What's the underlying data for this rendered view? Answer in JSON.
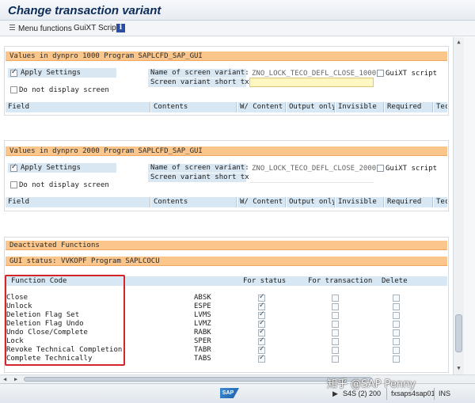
{
  "window": {
    "title": "Change transaction variant"
  },
  "toolbar": {
    "menu_functions": "Menu functions",
    "guixt_script": "GuiXT Script",
    "info": "i"
  },
  "dynpro1000": {
    "header": "Values in dynpro 1000 Program  SAPLCFD_SAP_GUI",
    "apply_settings": "Apply Settings",
    "apply_checked": true,
    "do_not_display": "Do not display screen",
    "do_not_display_checked": false,
    "name_label": "Name of screen variant:",
    "name_value": "ZNO_LOCK_TECO_DEFL_CLOSE_1000",
    "short_txt_label": "Screen variant short txt",
    "short_txt_value": "",
    "guixt_label": "GuiXT script",
    "guixt_checked": false
  },
  "dynpro2000": {
    "header": "Values in dynpro 2000 Program  SAPLCFD_SAP_GUI",
    "apply_settings": "Apply Settings",
    "apply_checked": true,
    "do_not_display": "Do not display screen",
    "do_not_display_checked": false,
    "name_label": "Name of screen variant:",
    "name_value": "ZNO_LOCK_TECO_DEFL_CLOSE_2000",
    "short_txt_label": "Screen variant short txt",
    "short_txt_value": "",
    "guixt_label": "GuiXT script",
    "guixt_checked": false
  },
  "columns": [
    "Field",
    "Contents",
    "W/ Content",
    "Output only",
    "Invisible",
    "Required",
    "Tec"
  ],
  "deactivated": {
    "header": "Deactivated Functions",
    "gui_status": "GUI status: VVKOPF Program SAPLCOCU",
    "col_function_code": "Function Code",
    "col_for_status": "For status",
    "col_for_transaction": "For transaction",
    "col_delete": "Delete",
    "rows": [
      {
        "name": "Close",
        "code": "ABSK",
        "for_status": true,
        "for_transaction": false,
        "delete": false
      },
      {
        "name": "Unlock",
        "code": "ESPE",
        "for_status": true,
        "for_transaction": false,
        "delete": false
      },
      {
        "name": "Deletion Flag Set",
        "code": "LVMS",
        "for_status": true,
        "for_transaction": false,
        "delete": false
      },
      {
        "name": "Deletion Flag Undo",
        "code": "LVMZ",
        "for_status": true,
        "for_transaction": false,
        "delete": false
      },
      {
        "name": "Undo Close/Complete",
        "code": "RABK",
        "for_status": true,
        "for_transaction": false,
        "delete": false
      },
      {
        "name": "Lock",
        "code": "SPER",
        "for_status": true,
        "for_transaction": false,
        "delete": false
      },
      {
        "name": "Revoke Technical Completion",
        "code": "TABR",
        "for_status": true,
        "for_transaction": false,
        "delete": false
      },
      {
        "name": "Complete Technically",
        "code": "TABS",
        "for_status": true,
        "for_transaction": false,
        "delete": false
      }
    ]
  },
  "statusbar": {
    "logo": "SAP",
    "system": "S4S (2) 200",
    "server": "fxsaps4sap01",
    "mode": "INS"
  },
  "watermark": "知乎 @SAP Penny",
  "colors": {
    "section_header": "#fbc68b",
    "label_bg": "#d9e7f2",
    "column_header": "#d7e8f4",
    "highlight_box": "#d4252b"
  }
}
